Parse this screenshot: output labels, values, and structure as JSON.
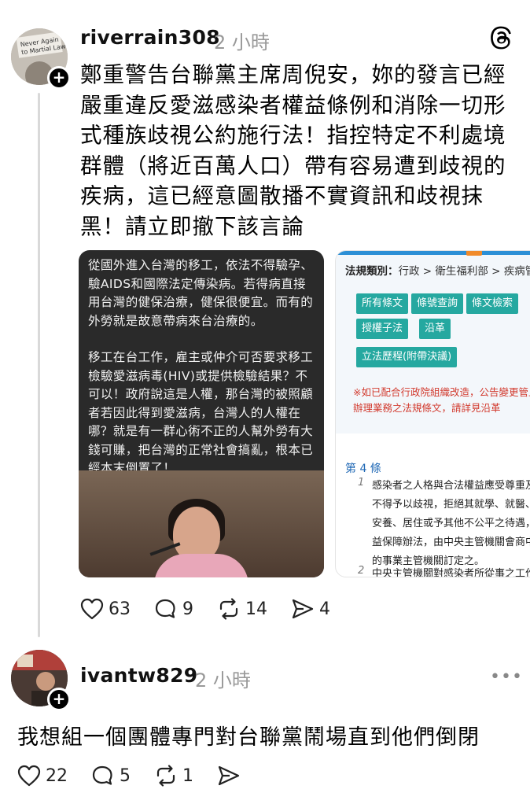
{
  "post1": {
    "username": "riverrain308",
    "time": "2 小時",
    "avatar_text": "Never Again to Martial Law",
    "text": "鄭重警告台聯黨主席周倪安，妳的發言已經嚴重違反愛滋感染者權益條例和消除一切形式種族歧視公約施行法！指控特定不利處境群體（將近百萬人口）帶有容易遭到歧視的疾病，這已經意圖散播不實資訊和歧視抹黑！請立即撤下該言論",
    "image1": {
      "paragraph1": "從國外進入台灣的移工，依法不得驗孕、驗AIDS和國際法定傳染病。若得病直接用台灣的健保治療，健保很便宜。而有的外勞就是故意帶病來台治療的。",
      "paragraph2": "移工在台工作，雇主或仲介可否要求移工檢驗愛滋病毒(HIV)或提供檢驗結果？不可以！政府說這是人權，那台灣的被照顧者若因此得到愛滋病，台灣人的人權在哪？就是有一群心術不正的人幫外勞有大錢可賺，把台灣的正常社會搞亂，根本已經本末倒置了！"
    },
    "image2": {
      "category_label": "法規類別：",
      "category_path": "行政 > 衛生福利部 > 疾病管",
      "buttons": [
        "所有條文",
        "條號查詢",
        "條文檢索",
        "授權子法",
        "沿革",
        "立法歷程(附帶決議)"
      ],
      "notice": "※如已配合行政院組織改造，公告變更管止辦理業務之法規條文，請詳見沿革",
      "article_title": "第 4 條",
      "article_lines": [
        "感染者之人格與合法權益應受尊重及",
        "不得予以歧視，拒絕其就學、就醫、",
        "安養、居住或予其他不公平之待遇，",
        "益保障辦法，由中央主管機關會商中",
        "的事業主管機關訂定之。"
      ],
      "article_num1": "1",
      "article_num2": "2",
      "article_line2": "中央主管機關對感染者所從事之工作"
    },
    "stats": {
      "likes": "63",
      "comments": "9",
      "reposts": "14",
      "shares": "4"
    }
  },
  "post2": {
    "username": "ivantw829",
    "time": "2 小時",
    "text": "我想組一個團體專門對台聯黨鬧場直到他們倒閉",
    "stats": {
      "likes": "22",
      "comments": "5",
      "reposts": "1"
    }
  },
  "icons": {
    "threads_logo": "threads-logo-icon",
    "more": "more-icon",
    "like": "heart-icon",
    "comment": "comment-icon",
    "repost": "repost-icon",
    "share": "share-icon"
  },
  "colors": {
    "teal_button": "#25a8a0",
    "notice_red": "#d23a2e",
    "article_blue": "#1f68b5",
    "muted_text": "#999999"
  }
}
